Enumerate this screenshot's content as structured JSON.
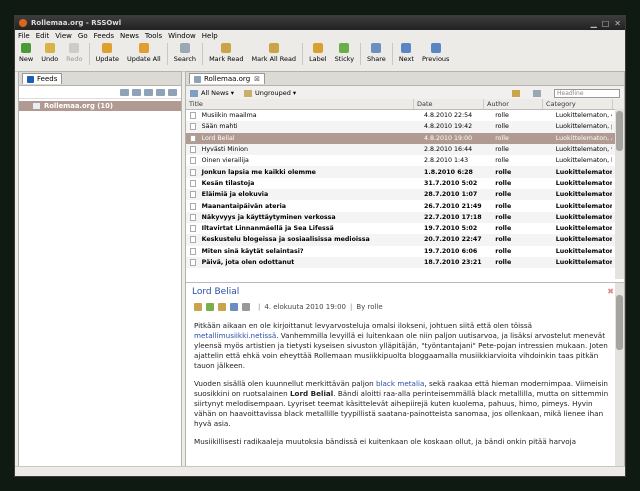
{
  "window": {
    "title": "Rollemaa.org - RSSOwl"
  },
  "menu": [
    "File",
    "Edit",
    "View",
    "Go",
    "Feeds",
    "News",
    "Tools",
    "Window",
    "Help"
  ],
  "toolbar": {
    "new": "New",
    "undo": "Undo",
    "redo": "Redo",
    "update": "Update",
    "update_all": "Update All",
    "search": "Search",
    "mark_read": "Mark Read",
    "mark_all_read": "Mark All Read",
    "label": "Label",
    "sticky": "Sticky",
    "share": "Share",
    "next": "Next",
    "previous": "Previous"
  },
  "feeds_panel": {
    "tab": "Feeds",
    "item": "Rollemaa.org (10)"
  },
  "news_panel": {
    "tab": "Rollemaa.org",
    "filter_all": "All News",
    "filter_group": "Ungrouped",
    "search_placeholder": "Headline",
    "columns": {
      "title": "Title",
      "date": "Date",
      "author": "Author",
      "category": "Category"
    },
    "rows": [
      {
        "title": "Musiikin maailma",
        "date": "4.8.2010 22:54",
        "author": "rolle",
        "category": "Luokittelematon, es",
        "unread": false,
        "selected": false
      },
      {
        "title": "Sään mahti",
        "date": "4.8.2010 19:42",
        "author": "rolle",
        "category": "Luokittelematon, ph",
        "unread": false,
        "selected": false
      },
      {
        "title": "Lord Belial",
        "date": "4.8.2010 19:00",
        "author": "rolle",
        "category": "Luokittelematon, Ar",
        "unread": false,
        "selected": true
      },
      {
        "title": "Hyvästi Minion",
        "date": "2.8.2010 16:44",
        "author": "rolle",
        "category": "Luokittelematon, va",
        "unread": false,
        "selected": false
      },
      {
        "title": "Öinen vierailija",
        "date": "2.8.2010 1:43",
        "author": "rolle",
        "category": "Luokittelematon, hy",
        "unread": false,
        "selected": false
      },
      {
        "title": "Jonkun lapsia me kaikki olemme",
        "date": "1.8.2010 6:28",
        "author": "rolle",
        "category": "Luokittelematon,",
        "unread": true,
        "selected": false
      },
      {
        "title": "Kesän tilastoja",
        "date": "31.7.2010 5:02",
        "author": "rolle",
        "category": "Luokittelematon,",
        "unread": true,
        "selected": false
      },
      {
        "title": "Eläimiä ja elokuvia",
        "date": "28.7.2010 1:07",
        "author": "rolle",
        "category": "Luokittelematon,",
        "unread": true,
        "selected": false
      },
      {
        "title": "Maanantaipäivän ateria",
        "date": "26.7.2010 21:49",
        "author": "rolle",
        "category": "Luokittelematon,",
        "unread": true,
        "selected": false
      },
      {
        "title": "Näkyvyys ja käyttäytyminen verkossa",
        "date": "22.7.2010 17:18",
        "author": "rolle",
        "category": "Luokittelematon,",
        "unread": true,
        "selected": false
      },
      {
        "title": "Iltavirtat Linnanmäellä ja Sea Lifessä",
        "date": "19.7.2010 5:02",
        "author": "rolle",
        "category": "Luokittelematon,",
        "unread": true,
        "selected": false
      },
      {
        "title": "Keskustelu blogeissa ja sosiaalisissa medioissa",
        "date": "20.7.2010 22:47",
        "author": "rolle",
        "category": "Luokittelematon,",
        "unread": true,
        "selected": false
      },
      {
        "title": "Miten sinä käytät selaintasi?",
        "date": "19.7.2010 6:06",
        "author": "rolle",
        "category": "Luokittelematon,",
        "unread": true,
        "selected": false
      },
      {
        "title": "Päivä, jota olen odottanut",
        "date": "18.7.2010 23:21",
        "author": "rolle",
        "category": "Luokittelematon,",
        "unread": true,
        "selected": false
      }
    ]
  },
  "preview": {
    "title": "Lord Belial",
    "date": "4. elokuuta 2010 19:00",
    "by": "By rolle",
    "p1_pre": "Pitkään aikaan en ole kirjoittanut levyarvosteluja omalsi ilokseni, johtuen siitä että olen töissä ",
    "p1_link": "metallimusiikki.netissä",
    "p1_post": ". Vanhemmilla levyillä ei luitenkaan ole niin paljon uutisarvoa, ja lisäksi arvostelut menevät yleensä myös artistien ja tietysti kyseisen sivuston ylläpitäjän, \"työntantajani\" Pete-pojan intressien mukaan. Joten ajattelin että ehkä voin eheyttää Rollemaan musiikkipuolta bloggaamalla musiikkiarvioita vihdoinkin taas pitkän tauon jälkeen.",
    "p2_pre": "Vuoden sisällä olen kuunnellut merkittävän paljon ",
    "p2_link": "black metalia",
    "p2_mid": ", sekä raakaa että hieman modernimpaa. Viimeisin suosikkini on ruotsalainen ",
    "p2_bold": "Lord Belial",
    "p2_post": ". Bändi aloitti raa-alla perinteisemmällä black metallilla, mutta on sittemmin siirtynyt melodisempaan. Lyyriset teemat käsittelevät aihepiirejä kuten kuolema, pahuus, himo, pimeys. Hyvin vähän on haavoittavissa black metallille tyypillistä saatana-painotteista sanomaa, jos ollenkaan, mikä lieneе ihan hyvä asia.",
    "p3": "Musiikillisesti radikaaleja muutoksia bändissä ei kuitenkaan ole koskaan ollut, ja bändi onkin pitää harvoja"
  }
}
